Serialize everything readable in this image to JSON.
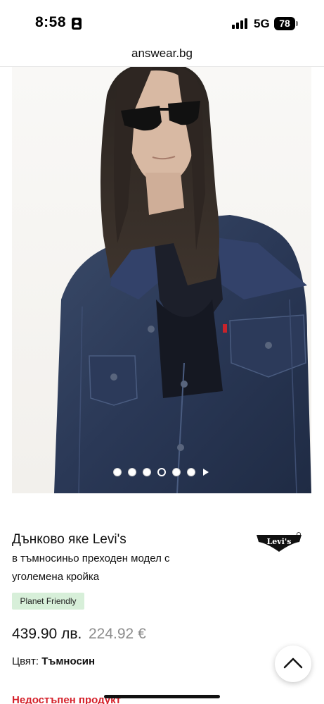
{
  "status_bar": {
    "time": "8:58",
    "network": "5G",
    "battery": "78"
  },
  "browser": {
    "url": "answear.bg"
  },
  "carousel": {
    "image_count": 6,
    "active_index": 3
  },
  "product": {
    "title": "Дънково яке Levi's",
    "description": "в тъмносиньо преходен модел с уголемена кройка",
    "brand_logo_text": "Levi's",
    "badge": "Planet Friendly",
    "price": "439.90 лв.",
    "price_alt": "224.92 €",
    "color_label": "Цвят:",
    "color_value": "Тъмносин",
    "availability": "Недостъпен продукт"
  },
  "colors": {
    "accent_red": "#d5202a",
    "badge_green": "#d7efd9",
    "denim": "#283652"
  },
  "icons": {
    "scroll_top": "chevron-up-icon",
    "carousel_next": "play-icon"
  }
}
